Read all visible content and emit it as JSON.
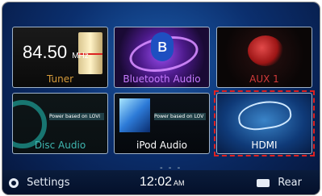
{
  "tiles": {
    "tuner": {
      "label": "Tuner",
      "freq": "84.50",
      "unit": "MHz",
      "label_color": "#d59a3a"
    },
    "bt": {
      "label": "Bluetooth Audio",
      "label_color": "#c77bff"
    },
    "aux": {
      "label": "AUX 1",
      "label_color": "#d23a3a"
    },
    "disc": {
      "label": "Disc Audio",
      "label_color": "#3fb6b0",
      "track": "Power based on LOVI"
    },
    "ipod": {
      "label": "iPod Audio",
      "label_color": "#ffffff",
      "track": "Power based on LOV"
    },
    "hdmi": {
      "label": "HDMI",
      "label_color": "#ffffff"
    }
  },
  "pager": "- - -",
  "bottom": {
    "settings": "Settings",
    "time": "12:02",
    "ampm": "AM",
    "rear": "Rear"
  },
  "colors": {
    "highlight": "#e02020"
  }
}
